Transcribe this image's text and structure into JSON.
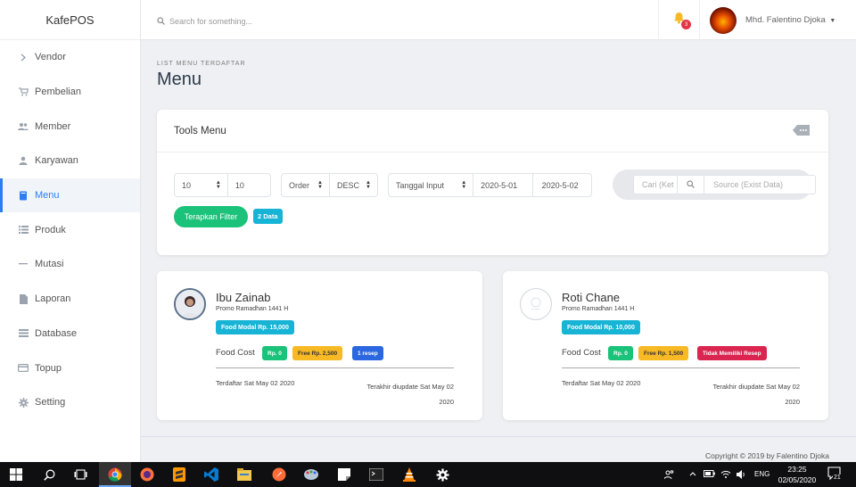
{
  "app": {
    "brand": "KafePOS"
  },
  "sidebar": {
    "items": [
      {
        "label": "Vendor",
        "icon": "chevron-right-icon"
      },
      {
        "label": "Pembelian",
        "icon": "cart-icon"
      },
      {
        "label": "Member",
        "icon": "users-icon"
      },
      {
        "label": "Karyawan",
        "icon": "user-icon"
      },
      {
        "label": "Menu",
        "icon": "book-icon",
        "active": true
      },
      {
        "label": "Produk",
        "icon": "list-icon"
      },
      {
        "label": "Mutasi",
        "icon": "minus-icon"
      },
      {
        "label": "Laporan",
        "icon": "file-icon"
      },
      {
        "label": "Database",
        "icon": "database-icon"
      },
      {
        "label": "Topup",
        "icon": "card-icon"
      },
      {
        "label": "Setting",
        "icon": "gear-icon"
      }
    ]
  },
  "topbar": {
    "search_placeholder": "Search for something...",
    "notification_count": "3",
    "user_name": "Mhd. Falentino Djoka"
  },
  "page": {
    "subtitle": "LIST MENU TERDAFTAR",
    "title": "Menu"
  },
  "tools": {
    "title": "Tools Menu",
    "limit_select": "10",
    "limit_input": "10",
    "order_select": "Order",
    "direction_select": "DESC",
    "date_field_select": "Tanggal Input",
    "date_from": "2020-5-01",
    "date_to": "2020-5-02",
    "search_placeholder": "Cari (Ket",
    "source_placeholder": "Source (Exist Data)",
    "apply_label": "Terapkan Filter",
    "data_count": "2 Data"
  },
  "cards": [
    {
      "name": "Ibu Zainab",
      "promo": "Promo Ramadhan 1441 H",
      "modal": "Food Modal Rp. 15,000",
      "food_cost_label": "Food Cost",
      "cost": "Rp. 0",
      "free": "Free Rp. 2,500",
      "resep": "1 resep",
      "registered": "Terdaftar Sat May 02 2020",
      "updated_1": "Terakhir diupdate Sat May 02",
      "updated_2": "2020"
    },
    {
      "name": "Roti Chane",
      "promo": "Promo Ramadhan 1441 H",
      "modal": "Food Modal Rp. 10,000",
      "food_cost_label": "Food Cost",
      "cost": "Rp. 0",
      "free": "Free Rp. 1,500",
      "resep": "Tidak Memiliki Resep",
      "registered": "Terdaftar Sat May 02 2020",
      "updated_1": "Terakhir diupdate Sat May 02",
      "updated_2": "2020"
    }
  ],
  "footer": {
    "copyright": "Copyright © 2019 by Falentino Djoka"
  },
  "taskbar": {
    "language": "ENG",
    "time": "23:25",
    "date": "02/05/2020",
    "notifications": "21",
    "colors": {
      "accent": "#2a7ef2",
      "success": "#1bc27a",
      "info": "#17b4d6",
      "warning": "#f7b924",
      "danger": "#d92550"
    }
  }
}
